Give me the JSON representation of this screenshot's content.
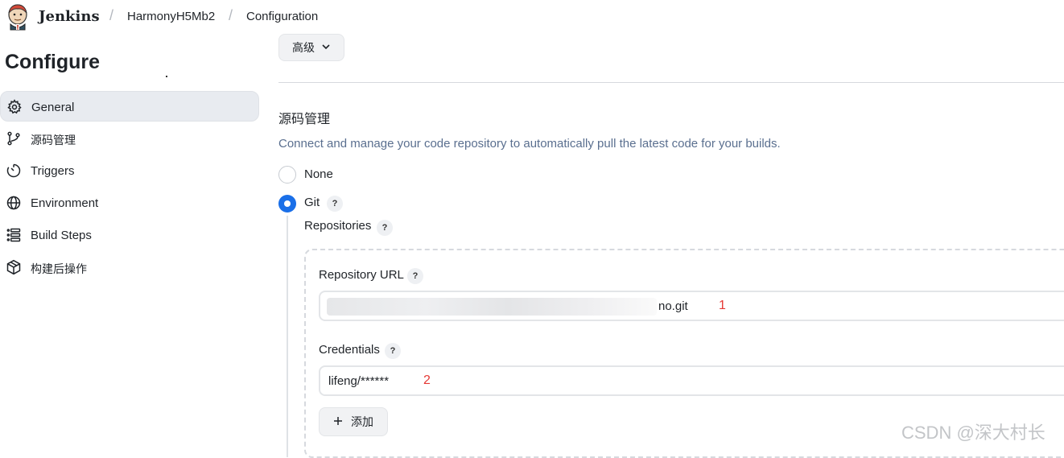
{
  "header": {
    "brand": "Jenkins",
    "breadcrumbs": [
      "HarmonyH5Mb2",
      "Configuration"
    ],
    "separator": "/"
  },
  "page": {
    "title": "Configure"
  },
  "sidebar": {
    "items": [
      {
        "label": "General",
        "icon": "gear-icon",
        "active": true
      },
      {
        "label": "源码管理",
        "icon": "branch-icon",
        "active": false
      },
      {
        "label": "Triggers",
        "icon": "timer-icon",
        "active": false
      },
      {
        "label": "Environment",
        "icon": "globe-icon",
        "active": false
      },
      {
        "label": "Build Steps",
        "icon": "list-icon",
        "active": false
      },
      {
        "label": "构建后操作",
        "icon": "package-icon",
        "active": false
      }
    ]
  },
  "main": {
    "advanced_label": "高级",
    "section_title": "源码管理",
    "section_description": "Connect and manage your code repository to automatically pull the latest code for your builds.",
    "scm_options": [
      {
        "label": "None",
        "selected": false
      },
      {
        "label": "Git",
        "selected": true
      }
    ],
    "help_mark": "?",
    "repositories_label": "Repositories",
    "repository_url": {
      "label": "Repository URL",
      "value_visible_suffix": "no.git",
      "marker": "1"
    },
    "credentials": {
      "label": "Credentials",
      "value": "lifeng/******",
      "marker": "2"
    },
    "add_button": {
      "icon": "plus-icon",
      "label": "添加"
    }
  },
  "watermark": "CSDN @深大村长",
  "colors": {
    "accent": "#1a6fe8",
    "description": "#5a6f8f",
    "marker": "#e53935",
    "active_bg": "#e8ebf0"
  }
}
